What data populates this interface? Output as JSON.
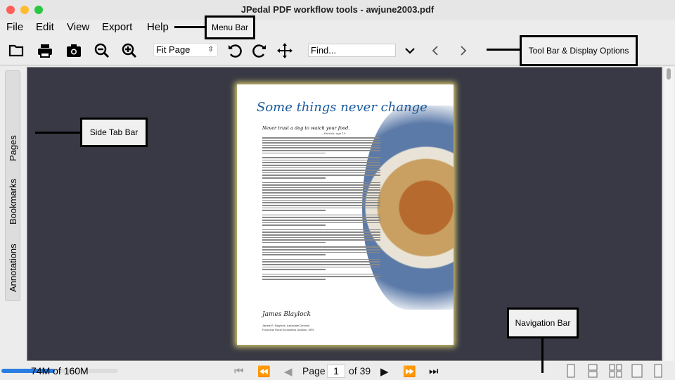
{
  "window": {
    "title": "JPedal PDF workflow tools - awjune2003.pdf"
  },
  "menu": [
    "File",
    "Edit",
    "View",
    "Export",
    "Help"
  ],
  "toolbar": {
    "zoom_value": "Fit Page",
    "find_placeholder": "Find..."
  },
  "side_tabs": [
    "Pages",
    "Bookmarks",
    "Annotations"
  ],
  "document": {
    "heading": "Some things never change",
    "subheading": "Never trust a dog to watch your food.",
    "attribution": "—Patrick, age 10",
    "signature": "James Blaylock",
    "signer": "James R. Blaylock, Associate Director",
    "signer_org": "Food and Rural Economics Division, ERS"
  },
  "status": {
    "memory": "74M of 160M",
    "memory_fraction": 0.46
  },
  "navigation": {
    "page_label": "Page",
    "page_value": "1",
    "of_label": "of 39"
  },
  "annotations": {
    "menu_bar": "Menu Bar",
    "tool_bar": "Tool Bar & Display Options",
    "side_tab": "Side Tab Bar",
    "nav_bar": "Navigation Bar"
  },
  "colors": {
    "viewer_bg": "#383944",
    "heading_blue": "#1a5a9a",
    "memory_bar": "#2a7de1"
  }
}
